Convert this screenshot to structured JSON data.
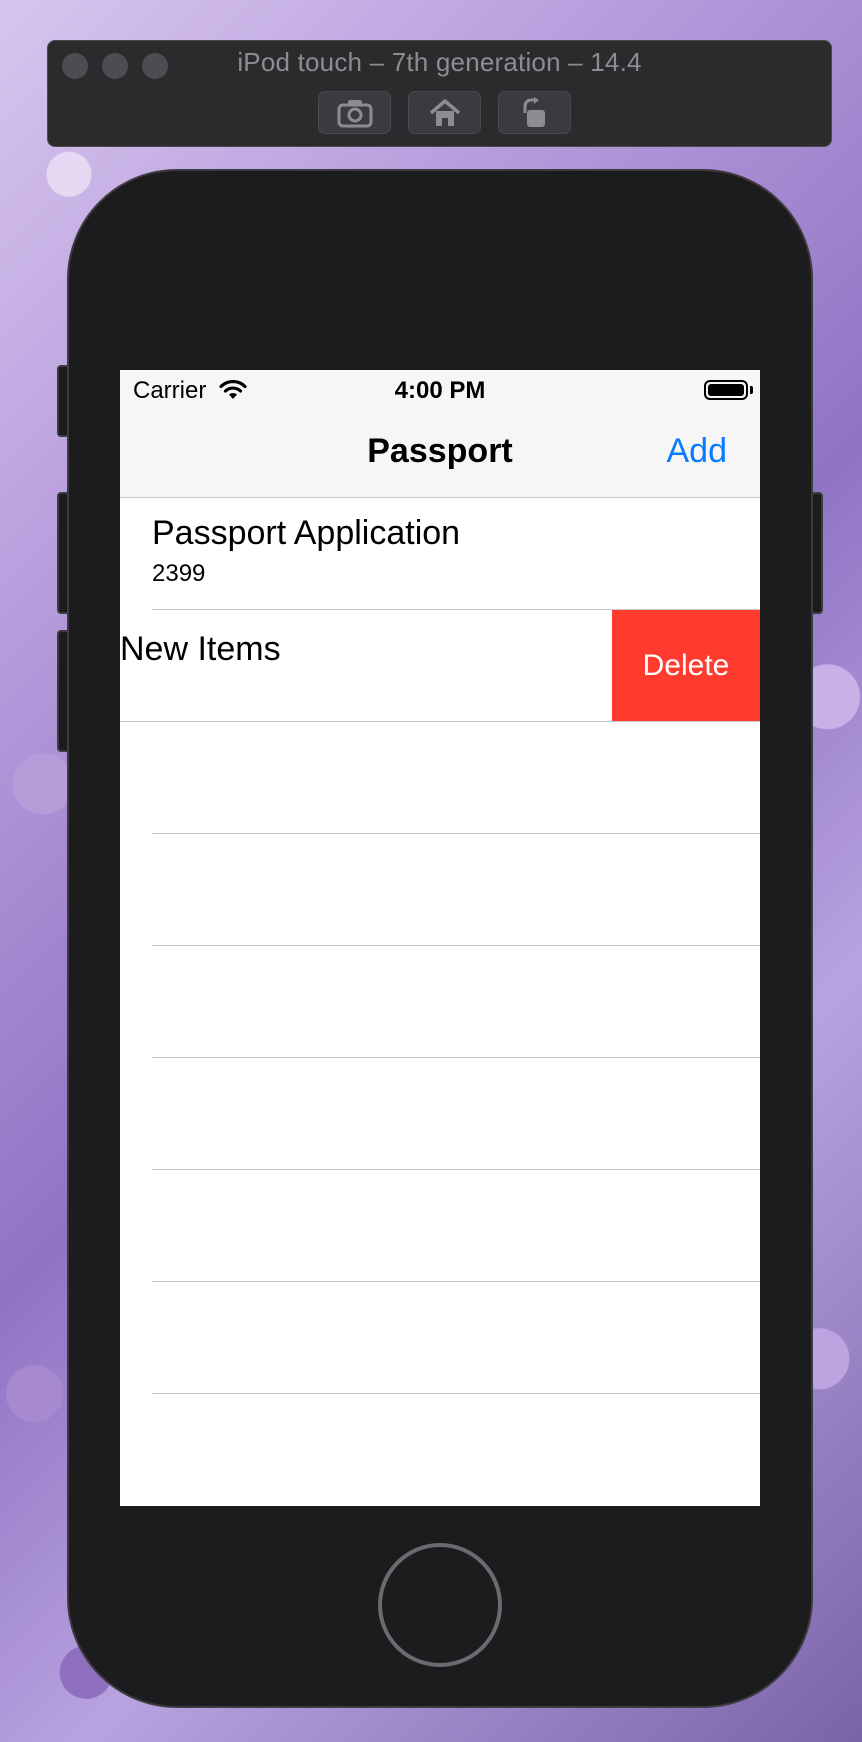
{
  "simulator": {
    "title": "iPod touch – 7th generation – 14.4",
    "buttons": [
      {
        "name": "screenshot",
        "icon": "camera-icon"
      },
      {
        "name": "home",
        "icon": "home-icon"
      },
      {
        "name": "rotate",
        "icon": "rotate-icon"
      }
    ]
  },
  "status_bar": {
    "carrier": "Carrier",
    "time": "4:00 PM"
  },
  "nav_bar": {
    "title": "Passport",
    "add_label": "Add"
  },
  "table": {
    "rows": [
      {
        "title": "Passport Application",
        "subtitle": "2399"
      },
      {
        "title": "New Items",
        "action_label": "Delete"
      }
    ]
  },
  "colors": {
    "accent": "#0a7aff",
    "destructive": "#ff3b30",
    "bar_background": "#f6f6f6"
  }
}
